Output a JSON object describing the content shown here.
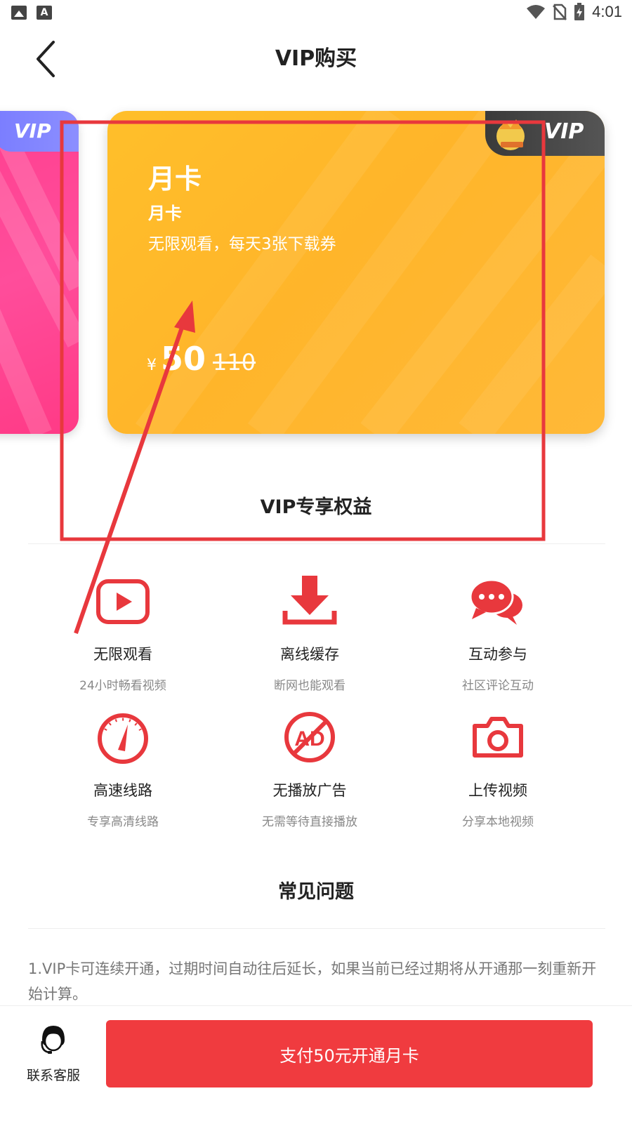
{
  "status_bar": {
    "time": "4:01",
    "icons": [
      "image-icon",
      "font-icon",
      "wifi-icon",
      "no-sim-icon",
      "battery-charging-icon"
    ]
  },
  "header": {
    "title": "VIP购买",
    "back_icon": "chevron-left-icon"
  },
  "cards": {
    "left_card": {
      "badge": "VIP",
      "color": "#ff4d9b"
    },
    "main_card": {
      "badge": "VIP",
      "name": "月卡",
      "subtitle": "月卡",
      "description": "无限观看，每天3张下载券",
      "currency": "¥",
      "price": "50",
      "original_price": "110",
      "color": "#ffb52a"
    }
  },
  "benefits": {
    "title": "VIP专享权益",
    "items": [
      {
        "label": "无限观看",
        "desc": "24小时畅看视频",
        "icon": "play-icon"
      },
      {
        "label": "离线缓存",
        "desc": "断网也能观看",
        "icon": "download-icon"
      },
      {
        "label": "互动参与",
        "desc": "社区评论互动",
        "icon": "chat-icon"
      },
      {
        "label": "高速线路",
        "desc": "专享高清线路",
        "icon": "speedometer-icon"
      },
      {
        "label": "无播放广告",
        "desc": "无需等待直接播放",
        "icon": "no-ad-icon"
      },
      {
        "label": "上传视频",
        "desc": "分享本地视频",
        "icon": "camera-icon"
      }
    ]
  },
  "faq": {
    "title": "常见问题",
    "items": [
      "1.VIP卡可连续开通，过期时间自动往后延长，如果当前已经过期将从开通那一刻重新开始计算。"
    ]
  },
  "bottom_bar": {
    "support_label": "联系客服",
    "pay_label": "支付50元开通月卡"
  },
  "colors": {
    "accent": "#f03b3f",
    "card_orange": "#ffb52a",
    "card_pink": "#ff4d9b",
    "annotation": "#e8383d"
  }
}
